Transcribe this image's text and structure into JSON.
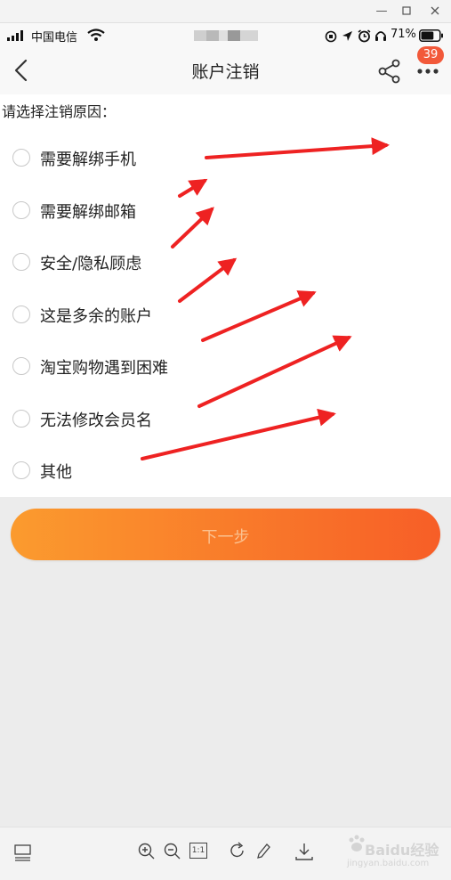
{
  "status_bar": {
    "carrier": "中国电信",
    "battery_percent": "71%",
    "battery_level": 0.71
  },
  "nav": {
    "title": "账户注销",
    "notification_count": "39"
  },
  "form": {
    "prompt": "请选择注销原因：",
    "options": [
      {
        "label": "需要解绑手机",
        "selected": false
      },
      {
        "label": "需要解绑邮箱",
        "selected": false
      },
      {
        "label": "安全/隐私顾虑",
        "selected": false
      },
      {
        "label": "这是多余的账户",
        "selected": false
      },
      {
        "label": "淘宝购物遇到困难",
        "selected": false
      },
      {
        "label": "无法修改会员名",
        "selected": false
      },
      {
        "label": "其他",
        "selected": false
      }
    ],
    "next_label": "下一步"
  },
  "viewer_toolbar": {
    "zoom_reset_label": "1:1"
  },
  "watermark": {
    "brand": "Baidu经验",
    "site": "jingyan.baidu.com"
  },
  "colors": {
    "accent_start": "#fb9b2e",
    "accent_end": "#f75e27",
    "badge": "#f2593a",
    "annotation_arrow": "#ee2222"
  }
}
